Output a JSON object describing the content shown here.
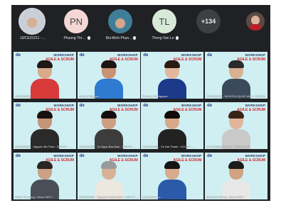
{
  "participants": [
    {
      "name": "19/CE31311 - ...",
      "avatar_type": "photo",
      "color": "#7a8fa8"
    },
    {
      "name": "Phuong Thi ...",
      "initials": "PN",
      "avatar_type": "initials",
      "mic": "muted-mic-icon"
    },
    {
      "name": "Bùi Minh Phụn...",
      "avatar_type": "photo",
      "color": "#2f6f8a",
      "mic": "muted-mic-icon"
    },
    {
      "name": "Thong Van Le",
      "initials": "TL",
      "avatar_type": "initials",
      "mic": "muted-mic-icon"
    },
    {
      "more_count": "+134",
      "avatar_type": "more"
    }
  ],
  "watermark": {
    "line1": "WORKSHOP",
    "line2": "AGILE & SCRUM",
    "logo": "de"
  },
  "tiles": [
    {
      "label": "19/CE31259 - ...",
      "shirt": "#d83a3a",
      "skin": "#d9a98a",
      "hair": "#1f1815"
    },
    {
      "label": "Hung M Nguyen",
      "shirt": "#2e7bd1",
      "skin": "#c99272",
      "hair": "#1c1512"
    },
    {
      "label": "Phuong Thi Nguyen",
      "shirt": "#1b3a8a",
      "skin": "#e2b79d",
      "hair": "#2b1a14"
    },
    {
      "label": "19/CE31122 - NGUYEN QUOC ANH - K24 HN",
      "shirt": "#3a4a5a",
      "skin": "#d8b092",
      "hair": "#2a2a2a"
    },
    {
      "label": "19/CE31067 - Nguyen Ba Thao - K24 HT - ...",
      "shirt": "#2a2a2a",
      "skin": "#c69476",
      "hair": "#161210"
    },
    {
      "label": "19/CE31004 - Vu Ngoc Bao Bao - K24 HT - ...",
      "shirt": "#3c3c3c",
      "skin": "#cf9e80",
      "hair": "#141010"
    },
    {
      "label": "19/CE31066 - Vo Dai Thanh - K24 HT - ...",
      "shirt": "#222222",
      "skin": "#d8a888",
      "hair": "#0f0c0a"
    },
    {
      "label": "Le Thi Nguyen Chau - Khoa CNTT",
      "shirt": "#c9c9c9",
      "skin": "#e0b59a",
      "hair": "#3a2418"
    },
    {
      "label": "Pham Thi Hong - Khoa CNTT",
      "shirt": "#4a4f57",
      "skin": "#caa087",
      "hair": "#2a2422"
    },
    {
      "label": "19/CE31094 - Nguyen Hoanh Minh - K24 HT ...",
      "shirt": "#ece7df",
      "skin": "#d9b197",
      "hair": "#9a9a9a"
    },
    {
      "label": "Hoang Van Le",
      "shirt": "#2a5aa8",
      "skin": "#d6ab8e",
      "hair": "#151515"
    },
    {
      "label": "Bui Minh Phung - Khoa CNTT",
      "shirt": "#e8e8e8",
      "skin": "#d2a283",
      "hair": "#1b1b1b"
    }
  ]
}
